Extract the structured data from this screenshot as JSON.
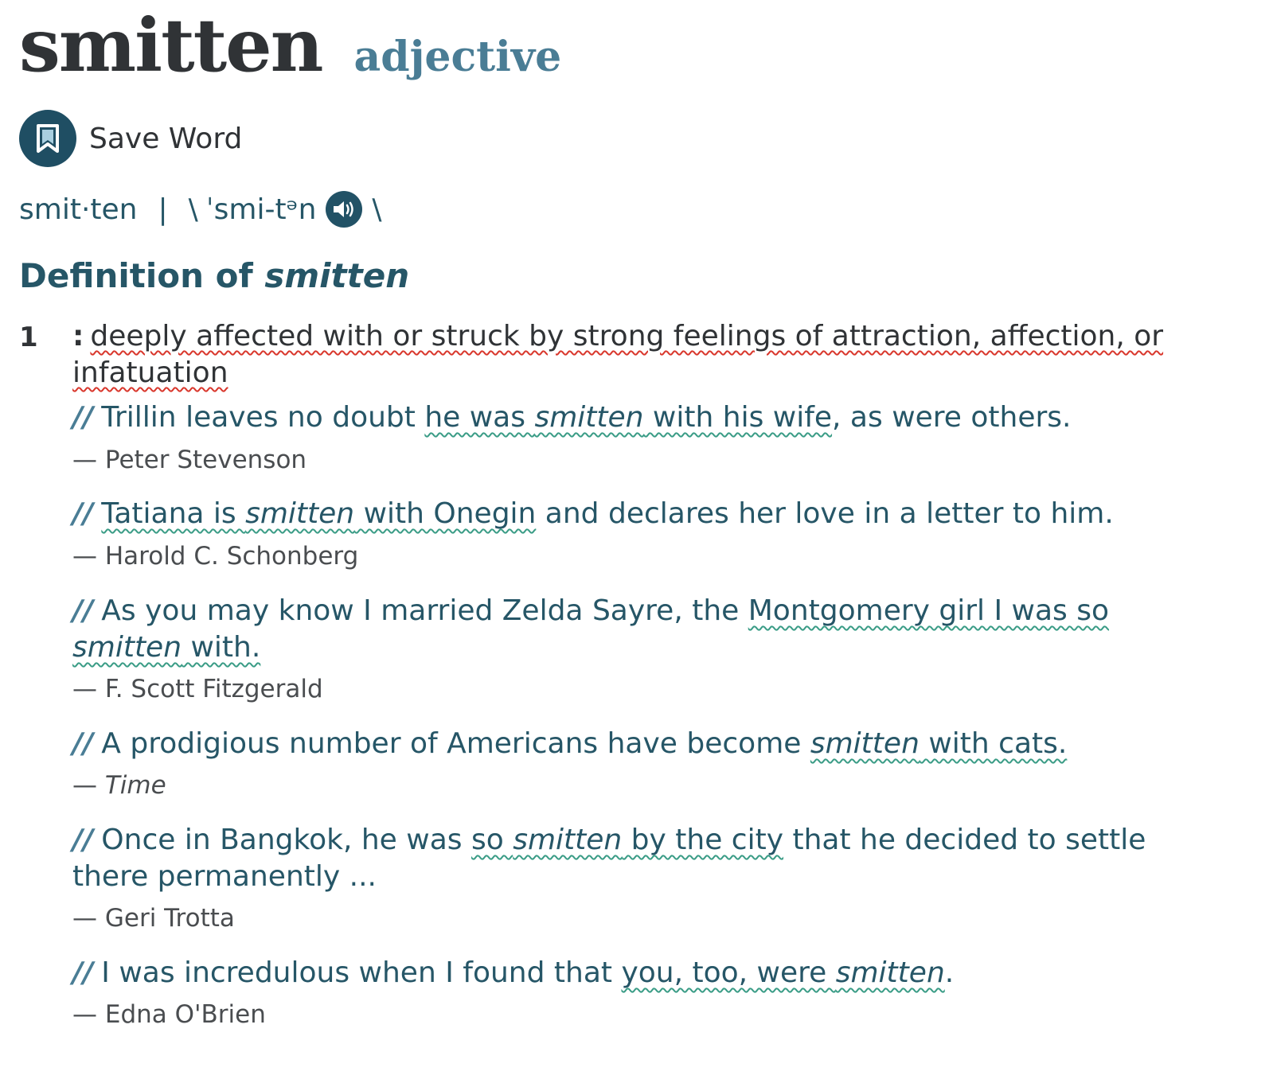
{
  "headword": {
    "word": "smitten",
    "part_of_speech": "adjective"
  },
  "save": {
    "label": "Save Word",
    "icon": "bookmark-icon"
  },
  "pronunciation": {
    "syllables": "smit·ten",
    "separator": "|",
    "open": "\\",
    "ipa": "ˈsmi-tᵊn",
    "close": "\\",
    "audio_icon": "speaker-icon"
  },
  "definition": {
    "heading_prefix": "Definition of",
    "heading_word": "smitten",
    "sense_number": "1",
    "colon": ":",
    "text": "deeply affected with or struck by strong feelings of attraction, affection, or infatuation"
  },
  "examples": [
    {
      "pre": "Trillin leaves no doubt ",
      "hl_pre": "he was ",
      "hl_em": "smitten",
      "hl_post": " with his wife",
      "post": ", as were others.",
      "source": "— Peter Stevenson",
      "source_italic": false
    },
    {
      "pre": "",
      "hl_pre": "Tatiana is ",
      "hl_em": "smitten",
      "hl_post": " with Onegin",
      "post": " and declares her love in a letter to him.",
      "source": "— Harold C. Schonberg",
      "source_italic": false
    },
    {
      "pre": "As you may know I married Zelda Sayre, the ",
      "hl_pre": "Montgomery girl I was so ",
      "hl_em": "smitten",
      "hl_post": " with.",
      "post": "",
      "source": "— F. Scott Fitzgerald",
      "source_italic": false
    },
    {
      "pre": "A prodigious number of Americans have become ",
      "hl_pre": "",
      "hl_em": "smitten",
      "hl_post": " with cats.",
      "post": "",
      "source_dash": "— ",
      "source": "Time",
      "source_italic": true
    },
    {
      "pre": "Once in Bangkok, he was ",
      "hl_pre": "so ",
      "hl_em": "smitten",
      "hl_post": " by the city",
      "post": " that he decided to settle there permanently ...",
      "source": "— Geri Trotta",
      "source_italic": false
    },
    {
      "pre": "I was incredulous when I found that ",
      "hl_pre": "you, too, were ",
      "hl_em": "smitten",
      "hl_post": "",
      "post": ".",
      "source": "— Edna O'Brien",
      "source_italic": false
    }
  ]
}
